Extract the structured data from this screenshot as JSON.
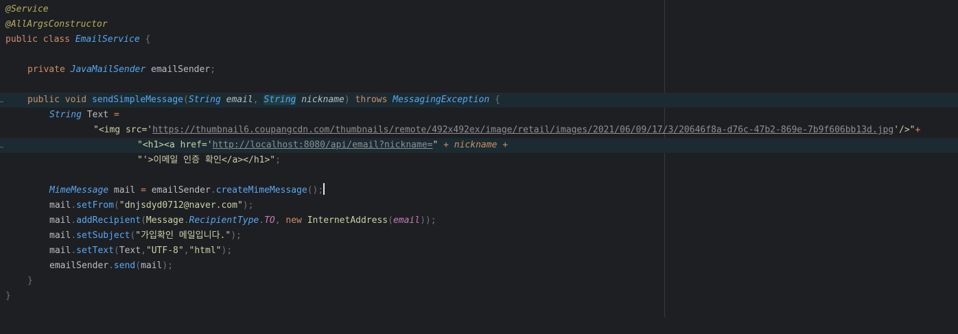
{
  "code": {
    "l1": "@Service",
    "l2": "@AllArgsConstructor",
    "l3": {
      "kw1": "public",
      "kw2": "class",
      "name": "EmailService",
      "brace": "{"
    },
    "l5": {
      "kw": "private",
      "type": "JavaMailSender",
      "name": "emailSender",
      "semi": ";"
    },
    "l7": {
      "kw1": "public",
      "kw2": "void",
      "fn": "sendSimpleMessage",
      "lp": "(",
      "t1": "String",
      "p1": "email",
      "comma": ",",
      "t2": "String",
      "p2": "nickname",
      "rp": ")",
      "throws": "throws",
      "ex": "MessagingException",
      "brace": "{"
    },
    "l8": {
      "type": "String",
      "name": "Text",
      "eq": "="
    },
    "l9": {
      "pre": "\"<img src='",
      "url": "https://thumbnail6.coupangcdn.com/thumbnails/remote/492x492ex/image/retail/images/2021/06/09/17/3/20646f8a-d76c-47b2-869e-7b9f606bb13d.jpg",
      "post": "'/>\"",
      "plus": "+"
    },
    "l10": {
      "pre": "\"<h1><a href='",
      "url": "http://localhost:8080/api/email?nickname=",
      "post": "\"",
      "plus1": "+",
      "var": "nickname",
      "plus2": "+"
    },
    "l11": {
      "str": "\"'>이메일 인증 확인</a></h1>\"",
      "semi": ";"
    },
    "l13": {
      "type": "MimeMessage",
      "name": "mail",
      "eq": "=",
      "obj": "emailSender",
      "dot": ".",
      "fn": "createMimeMessage",
      "paren": "()",
      "semi": ";"
    },
    "l14": {
      "obj": "mail",
      "fn": "setFrom",
      "arg": "\"dnjsdyd0712@naver.com\""
    },
    "l15": {
      "obj": "mail",
      "fn": "addRecipient",
      "cls": "Message",
      "inner": "RecipientType",
      "field": "TO",
      "kw": "new",
      "ctor": "InternetAddress",
      "param": "email"
    },
    "l16": {
      "obj": "mail",
      "fn": "setSubject",
      "arg": "\"가입확인 메일입니다.\""
    },
    "l17": {
      "obj": "mail",
      "fn": "setText",
      "a1": "Text",
      "a2": "\"UTF-8\"",
      "a3": "\"html\""
    },
    "l18": {
      "obj": "emailSender",
      "fn": "send",
      "arg": "mail"
    },
    "l19": "}",
    "l20": "}"
  }
}
